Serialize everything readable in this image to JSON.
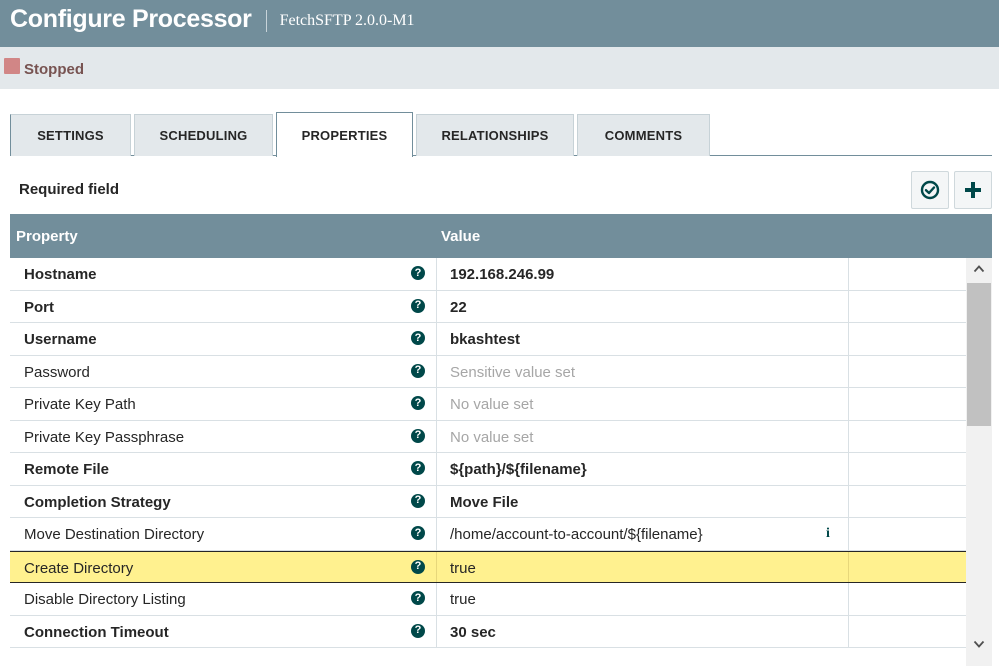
{
  "header": {
    "title": "Configure Processor",
    "subtitle": "FetchSFTP 2.0.0-M1"
  },
  "status": {
    "label": "Stopped",
    "color": "#d18686"
  },
  "tabs": [
    {
      "label": "SETTINGS",
      "selected": false
    },
    {
      "label": "SCHEDULING",
      "selected": false
    },
    {
      "label": "PROPERTIES",
      "selected": true
    },
    {
      "label": "RELATIONSHIPS",
      "selected": false
    },
    {
      "label": "COMMENTS",
      "selected": false
    }
  ],
  "properties_panel": {
    "required_label": "Required field",
    "verify_icon": "check-circle-icon",
    "add_icon": "plus-icon"
  },
  "table": {
    "columns": {
      "property": "Property",
      "value": "Value"
    },
    "rows": [
      {
        "name": "Hostname",
        "value": "192.168.246.99",
        "required": true,
        "state": "set"
      },
      {
        "name": "Port",
        "value": "22",
        "required": true,
        "state": "set"
      },
      {
        "name": "Username",
        "value": "bkashtest",
        "required": true,
        "state": "set"
      },
      {
        "name": "Password",
        "value": "Sensitive value set",
        "required": false,
        "state": "placeholder"
      },
      {
        "name": "Private Key Path",
        "value": "No value set",
        "required": false,
        "state": "placeholder"
      },
      {
        "name": "Private Key Passphrase",
        "value": "No value set",
        "required": false,
        "state": "placeholder"
      },
      {
        "name": "Remote File",
        "value": "${path}/${filename}",
        "required": true,
        "state": "set"
      },
      {
        "name": "Completion Strategy",
        "value": "Move File",
        "required": true,
        "state": "set"
      },
      {
        "name": "Move Destination Directory",
        "value": "/home/account-to-account/${filename}",
        "required": false,
        "state": "set",
        "info": true
      },
      {
        "name": "Create Directory",
        "value": "true",
        "required": false,
        "state": "set",
        "highlighted": true
      },
      {
        "name": "Disable Directory Listing",
        "value": "true",
        "required": false,
        "state": "set"
      },
      {
        "name": "Connection Timeout",
        "value": "30 sec",
        "required": true,
        "state": "set"
      }
    ],
    "help_glyph": "?",
    "info_glyph": "i"
  },
  "colors": {
    "header_bg": "#728e9b",
    "status_bar_bg": "#e3e8eb",
    "help_icon": "#004849",
    "highlight_row": "#fff18f"
  }
}
